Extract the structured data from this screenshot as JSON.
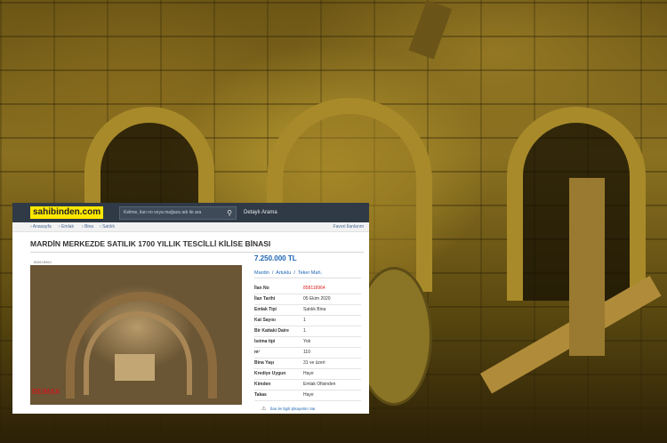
{
  "site": {
    "logo": "sahibinden.com",
    "search_placeholder": "Kelime, ilan no veya mağaza adı ile ara",
    "detailed_search": "Detaylı Arama"
  },
  "breadcrumb": {
    "items": [
      "Anasayfa",
      "Emlak",
      "Bina",
      "Satılık"
    ],
    "favorites": "Favori İlanlarım"
  },
  "listing": {
    "title": "MARDİN MERKEZDE SATILIK 1700 YILLIK TESCİLLİ KİLİSE BİNASI",
    "photo_id": "858118964",
    "agency_watermark": "RE/MAX",
    "price": "7.250.000 TL",
    "location": [
      "Mardin",
      "Artuklu",
      "Teker Mah."
    ],
    "details": [
      {
        "key": "İlan No",
        "value": "858118964"
      },
      {
        "key": "İlan Tarihi",
        "value": "05 Ekim 2020"
      },
      {
        "key": "Emlak Tipi",
        "value": "Satılık Bina"
      },
      {
        "key": "Kat Sayısı",
        "value": "1"
      },
      {
        "key": "Bir Kattaki Daire",
        "value": "1"
      },
      {
        "key": "Isıtma tipi",
        "value": "Yok"
      },
      {
        "key": "m²",
        "value": "110"
      },
      {
        "key": "Bina Yaşı",
        "value": "31 ve üzeri"
      },
      {
        "key": "Krediye Uygun",
        "value": "Hayır"
      },
      {
        "key": "Kimden",
        "value": "Emlak Ofisinden"
      },
      {
        "key": "Takas",
        "value": "Hayır"
      }
    ],
    "complaint_link": "İlan ile İlgili Şikayetim Var"
  },
  "icons": {
    "search": "search-icon",
    "warning": "warning-icon"
  },
  "colors": {
    "topbar": "#303a46",
    "logo_bg": "#ffe800",
    "link": "#1c64b4",
    "ilan_no": "#dd2222"
  }
}
